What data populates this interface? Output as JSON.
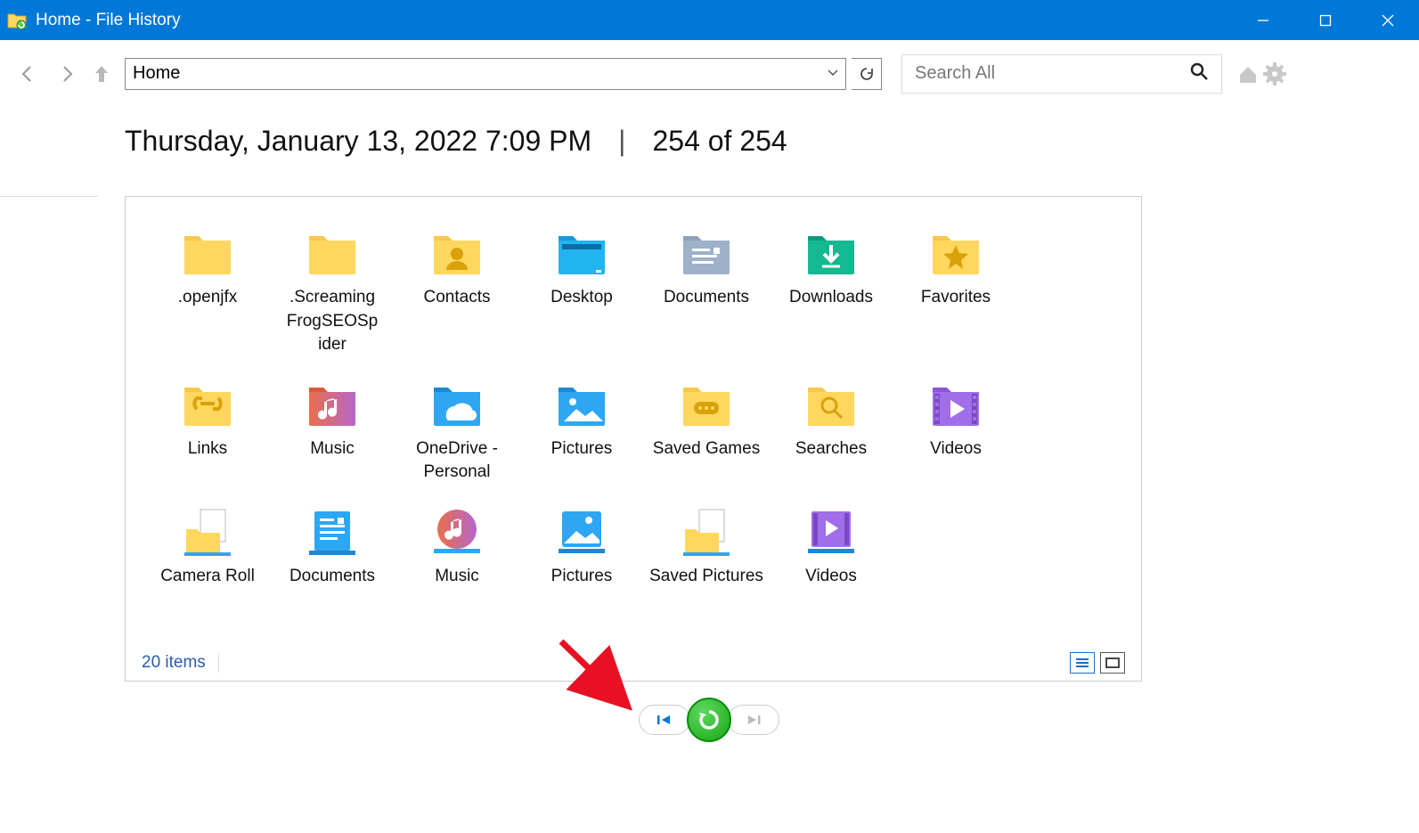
{
  "window": {
    "title": "Home - File History"
  },
  "toolbar": {
    "address": "Home",
    "search_placeholder": "Search All"
  },
  "header": {
    "timestamp": "Thursday, January 13, 2022 7:09 PM",
    "separator": "|",
    "counter": "254 of 254"
  },
  "items": [
    {
      "name": ".openjfx",
      "icon": "folder"
    },
    {
      "name": ".Screaming FrogSEOSp ider",
      "icon": "folder"
    },
    {
      "name": "Contacts",
      "icon": "folder-contact"
    },
    {
      "name": "Desktop",
      "icon": "desktop"
    },
    {
      "name": "Documents",
      "icon": "documents"
    },
    {
      "name": "Downloads",
      "icon": "downloads"
    },
    {
      "name": "Favorites",
      "icon": "favorites"
    },
    {
      "name": "Links",
      "icon": "links"
    },
    {
      "name": "Music",
      "icon": "music"
    },
    {
      "name": "OneDrive - Personal",
      "icon": "onedrive"
    },
    {
      "name": "Pictures",
      "icon": "pictures"
    },
    {
      "name": "Saved Games",
      "icon": "games"
    },
    {
      "name": "Searches",
      "icon": "searches"
    },
    {
      "name": "Videos",
      "icon": "videos"
    },
    {
      "name": "Camera Roll",
      "icon": "lib-camera"
    },
    {
      "name": "Documents",
      "icon": "lib-documents"
    },
    {
      "name": "Music",
      "icon": "lib-music"
    },
    {
      "name": "Pictures",
      "icon": "lib-pictures"
    },
    {
      "name": "Saved Pictures",
      "icon": "lib-saved"
    },
    {
      "name": "Videos",
      "icon": "lib-videos"
    }
  ],
  "status": {
    "count": "20 items"
  }
}
